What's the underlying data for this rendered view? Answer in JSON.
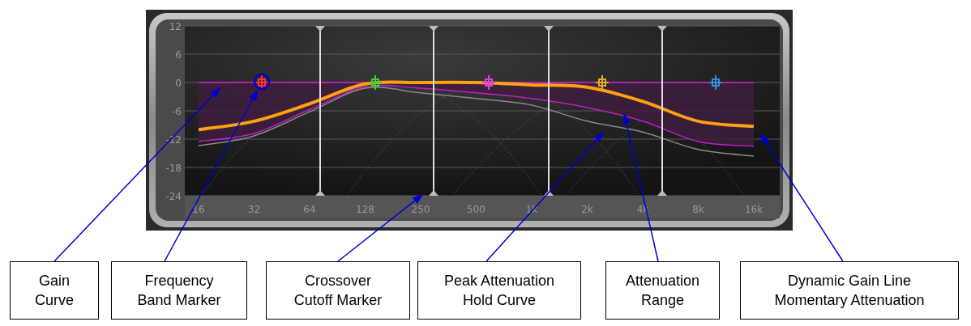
{
  "display": {
    "chart_data": {
      "type": "line",
      "categories": [
        "16",
        "32",
        "64",
        "128",
        "250",
        "500",
        "1k",
        "2k",
        "4k",
        "8k",
        "16k"
      ],
      "yticks": [
        12,
        6,
        0,
        -6,
        -12,
        -18,
        -24
      ],
      "ylim": [
        -24,
        12
      ],
      "grid": true,
      "series": [
        {
          "color": "#d020d0",
          "values": [
            0,
            0,
            0,
            0,
            0,
            0,
            0,
            0,
            0,
            0,
            0
          ]
        },
        {
          "color": "#8a8a8a",
          "values": [
            -13.4,
            -11.3,
            -6.2,
            -1.2,
            -2.2,
            -3.4,
            -4.8,
            -8.2,
            -10.5,
            -14.2,
            -15.6
          ]
        },
        {
          "color": "#c020c0",
          "values": [
            -12.5,
            -10.8,
            -5.7,
            -0.9,
            -1.2,
            -2.2,
            -3.4,
            -5.3,
            -8.2,
            -12.5,
            -13.5
          ]
        },
        {
          "color": "#ffa010",
          "values": [
            -10,
            -8.2,
            -4.5,
            -0.3,
            0,
            0,
            -0.5,
            -1,
            -4,
            -8.2,
            -9.3
          ]
        }
      ]
    },
    "band_markers": [
      {
        "color": "#ff3030"
      },
      {
        "color": "#40d040"
      },
      {
        "color": "#e040e0"
      },
      {
        "color": "#e0b020"
      },
      {
        "color": "#3090e0"
      }
    ]
  },
  "callouts": [
    {
      "lines": [
        "Gain",
        "Curve"
      ]
    },
    {
      "lines": [
        "Frequency",
        "Band Marker"
      ]
    },
    {
      "lines": [
        "Crossover",
        "Cutoff Marker"
      ]
    },
    {
      "lines": [
        "Peak Attenuation",
        "Hold Curve"
      ]
    },
    {
      "lines": [
        "Attenuation",
        "Range"
      ]
    },
    {
      "lines": [
        "Dynamic Gain Line",
        "Momentary Attenuation"
      ]
    }
  ]
}
